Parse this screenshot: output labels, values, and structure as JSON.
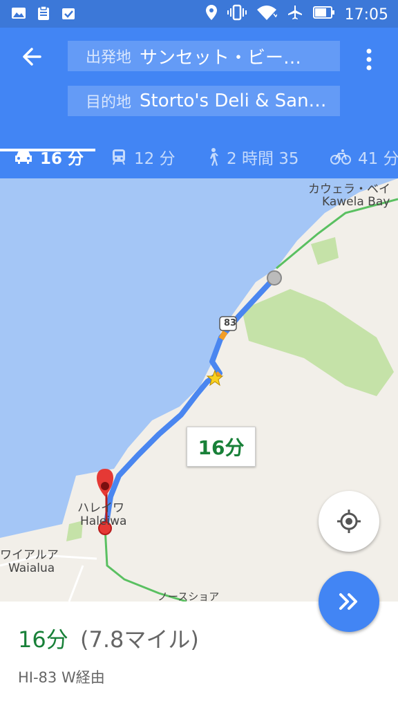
{
  "status_bar": {
    "time": "17:05",
    "left_icons": [
      "image-icon",
      "clipboard-icon",
      "task-check-icon"
    ],
    "right_icons": [
      "location-icon",
      "vibrate-icon",
      "wifi-icon",
      "airplane-icon",
      "battery-icon"
    ]
  },
  "header": {
    "origin_label": "出発地",
    "origin_value": "サンセット・ビー…",
    "destination_label": "目的地",
    "destination_value": "Storto's Deli & San…"
  },
  "tabs": [
    {
      "mode": "car-icon",
      "label": "16 分"
    },
    {
      "mode": "train-icon",
      "label": "12 分"
    },
    {
      "mode": "walk-icon",
      "label": "2 時間 35"
    },
    {
      "mode": "bike-icon",
      "label": "41 分"
    }
  ],
  "map": {
    "labels": {
      "kawela_jp": "カウェラ・ベイ",
      "kawela_en": "Kawela Bay",
      "haleiwa_jp": "ハレイワ",
      "haleiwa_en": "Haleiwa",
      "waialua_jp": "ワイアルア",
      "waialua_en": "Waialua",
      "northshore_jp": "ノースショア",
      "route_shield": "83"
    },
    "route_eta": "16分"
  },
  "summary": {
    "time": "16分",
    "distance": "(7.8マイル)",
    "via": "HI-83 W経由"
  },
  "colors": {
    "appbar": "#4285f4",
    "statusbar": "#3c78d8",
    "route": "#4a86f0",
    "eta_green": "#188038",
    "water": "#a4c6f6",
    "land": "#f2efe9"
  }
}
